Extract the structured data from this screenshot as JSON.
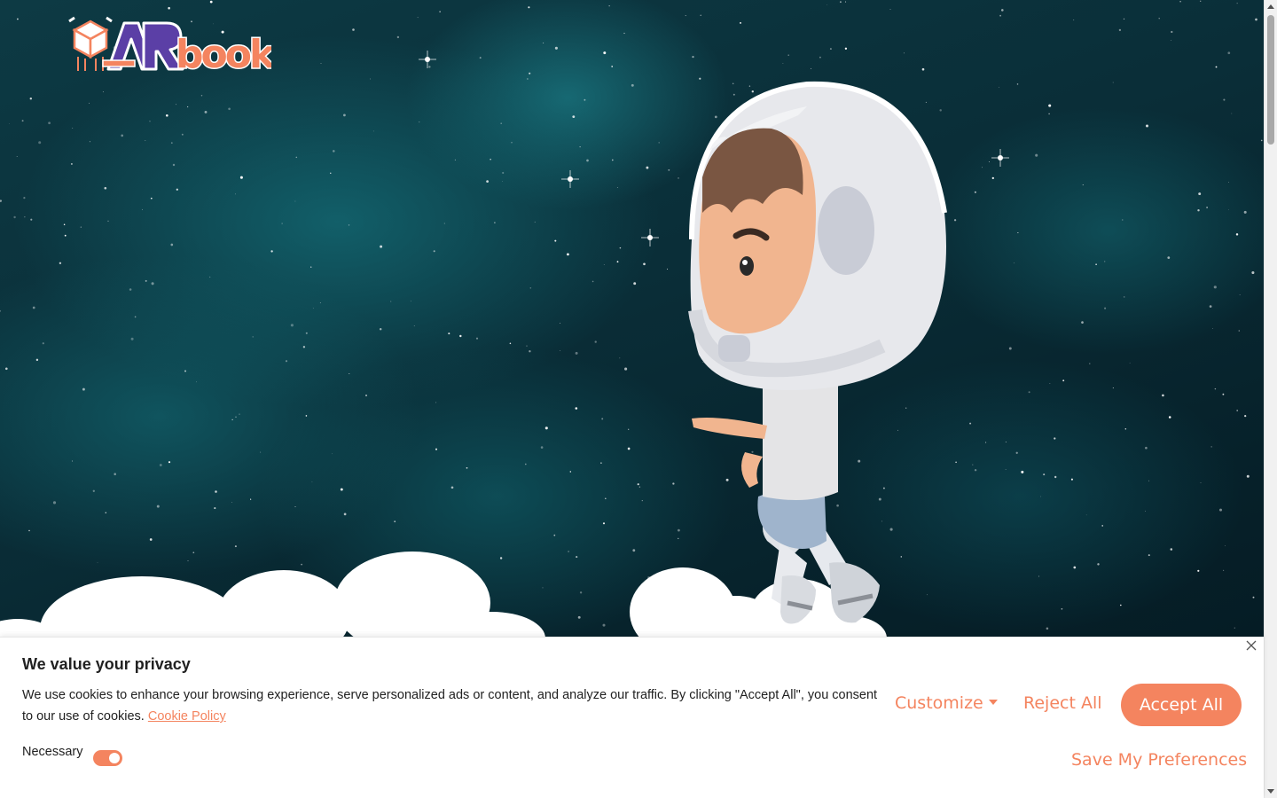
{
  "brand": {
    "logo_text": "ARbook",
    "colors": {
      "purple": "#5b3fa6",
      "orange": "#f4845f"
    }
  },
  "hero": {
    "background": "starfield-nebula",
    "illustration": "astronaut-child-icon"
  },
  "cookie_banner": {
    "title": "We value your privacy",
    "text": "We use cookies to enhance your browsing experience, serve personalized ads or content, and analyze our traffic. By clicking \"Accept All\", you consent to our use of cookies.",
    "policy_link": "Cookie Policy",
    "necessary_label": "Necessary",
    "necessary_enabled": true,
    "customize_label": "Customize",
    "reject_label": "Reject All",
    "accept_label": "Accept All",
    "save_label": "Save My Preferences",
    "close_icon": "close-icon",
    "accent_color": "#f4845f"
  }
}
